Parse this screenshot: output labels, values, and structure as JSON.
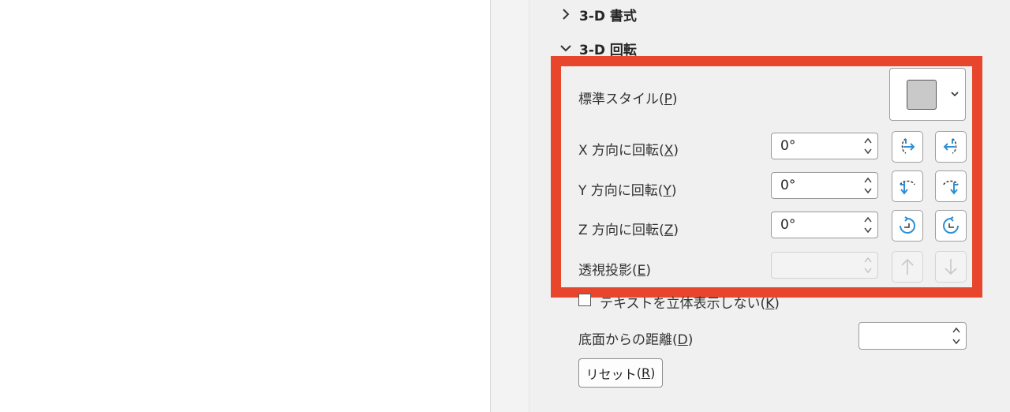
{
  "sections": {
    "format3d": {
      "label": "3-D 書式",
      "expanded": false
    },
    "rotation3d": {
      "label": "3-D 回転",
      "expanded": true
    }
  },
  "preset": {
    "label": "標準スタイル",
    "key": "P"
  },
  "rotation": {
    "x": {
      "label": "X 方向に回転",
      "key": "X",
      "value": "0°"
    },
    "y": {
      "label": "Y 方向に回転",
      "key": "Y",
      "value": "0°"
    },
    "z": {
      "label": "Z 方向に回転",
      "key": "Z",
      "value": "0°"
    }
  },
  "perspective": {
    "label": "透視投影",
    "key": "E",
    "value": ""
  },
  "keep_text_flat": {
    "label": "テキストを立体表示しない",
    "key": "K",
    "checked": false
  },
  "distance": {
    "label": "底面からの距離",
    "key": "D",
    "value": ""
  },
  "reset": {
    "label": "リセット",
    "key": "R"
  },
  "colors": {
    "highlight": "#e8462c",
    "icon_blue": "#2f8fd4",
    "swatch": "#c9c9c9"
  }
}
